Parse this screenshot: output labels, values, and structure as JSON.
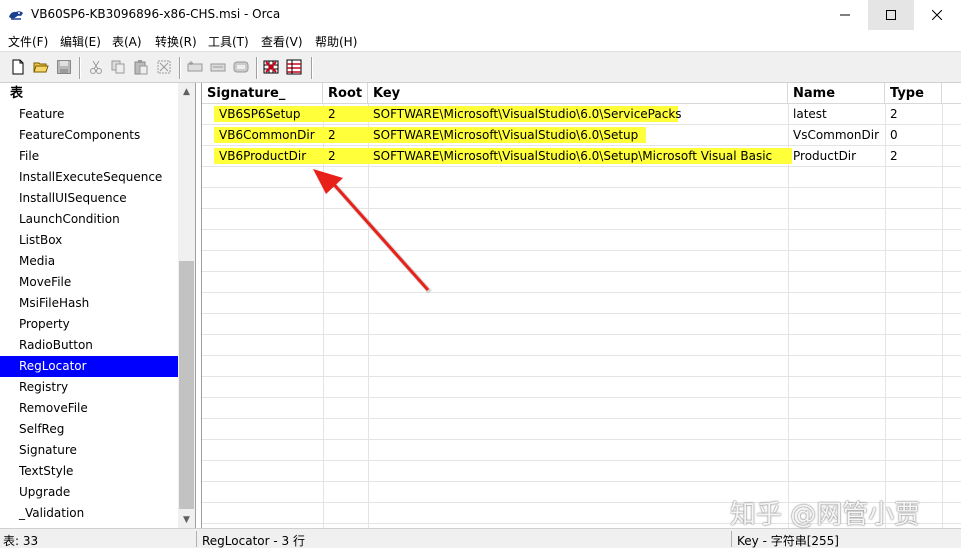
{
  "window": {
    "title": "VB60SP6-KB3096896-x86-CHS.msi - Orca",
    "icons": [
      "app-icon",
      "minimize-icon",
      "maximize-icon",
      "close-icon"
    ]
  },
  "menu": [
    "文件(F)",
    "编辑(E)",
    "表(A)",
    "转换(R)",
    "工具(T)",
    "查看(V)",
    "帮助(H)"
  ],
  "toolbar": {
    "icons": [
      "new-icon",
      "open-icon",
      "save-icon",
      "cut-icon",
      "copy-icon",
      "paste-icon",
      "delete-icon",
      "add-row-icon",
      "drop-row-icon",
      "table-icon",
      "validate-icon",
      "merge-icon"
    ]
  },
  "tables": {
    "header": "表",
    "items": [
      "Feature",
      "FeatureComponents",
      "File",
      "InstallExecuteSequence",
      "InstallUISequence",
      "LaunchCondition",
      "ListBox",
      "Media",
      "MoveFile",
      "MsiFileHash",
      "Property",
      "RadioButton",
      "RegLocator",
      "Registry",
      "RemoveFile",
      "SelfReg",
      "Signature",
      "TextStyle",
      "Upgrade",
      "_Validation"
    ],
    "selected": "RegLocator"
  },
  "grid": {
    "columns": [
      "Signature_",
      "Root",
      "Key",
      "Name",
      "Type"
    ],
    "rows": [
      [
        "VB6SP6Setup",
        "2",
        "SOFTWARE\\Microsoft\\VisualStudio\\6.0\\ServicePacks",
        "latest",
        "2"
      ],
      [
        "VB6CommonDir",
        "2",
        "SOFTWARE\\Microsoft\\VisualStudio\\6.0\\Setup",
        "VsCommonDir",
        "0"
      ],
      [
        "VB6ProductDir",
        "2",
        "SOFTWARE\\Microsoft\\VisualStudio\\6.0\\Setup\\Microsoft Visual Basic",
        "ProductDir",
        "2"
      ]
    ]
  },
  "status": {
    "tables": "表: 33",
    "table_info": "RegLocator - 3 行",
    "column_info": "Key - 字符串[255]"
  },
  "watermark": "知乎 @网管小贾",
  "colors": {
    "highlight": "#ffff3a",
    "selection": "#0000ff",
    "arrow": "#e8201a"
  }
}
